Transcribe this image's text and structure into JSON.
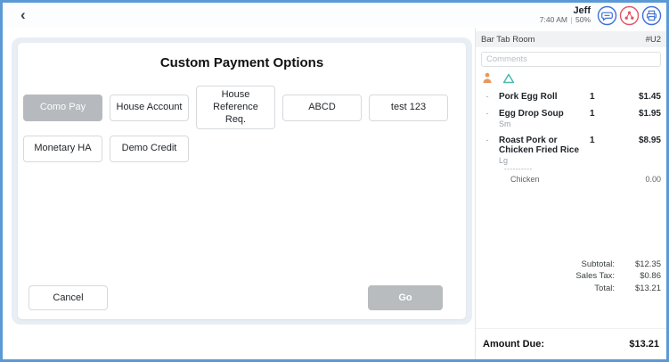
{
  "topbar": {
    "back_glyph": "‹",
    "user_name": "Jeff",
    "time": "7:40 AM",
    "battery": "50%"
  },
  "payment_modal": {
    "title": "Custom Payment Options",
    "options": [
      {
        "label": "Como Pay",
        "selected": true
      },
      {
        "label": "House Account",
        "selected": false
      },
      {
        "label": "House Reference Req.",
        "selected": false
      },
      {
        "label": "ABCD",
        "selected": false
      },
      {
        "label": "test 123",
        "selected": false
      },
      {
        "label": "Monetary HA",
        "selected": false
      },
      {
        "label": "Demo Credit",
        "selected": false
      }
    ],
    "cancel_label": "Cancel",
    "go_label": "Go"
  },
  "order_panel": {
    "room_name": "Bar Tab Room",
    "ticket_id": "#U2",
    "comments_placeholder": "Comments",
    "seat_icons": [
      "person-icon",
      "tent-icon"
    ],
    "items": [
      {
        "name": "Pork Egg Roll",
        "size": "",
        "qty": "1",
        "price": "$1.45",
        "modifiers": []
      },
      {
        "name": "Egg Drop Soup",
        "size": "Sm",
        "qty": "1",
        "price": "$1.95",
        "modifiers": []
      },
      {
        "name": "Roast Pork or Chicken Fried Rice",
        "size": "Lg",
        "qty": "1",
        "price": "$8.95",
        "modifier_separator": "----------",
        "modifiers": [
          {
            "name": "Chicken",
            "price": "0.00"
          }
        ]
      }
    ],
    "totals": [
      {
        "label": "Subtotal:",
        "value": "$12.35"
      },
      {
        "label": "Sales Tax:",
        "value": "$0.86"
      },
      {
        "label": "Total:",
        "value": "$13.21"
      }
    ],
    "amount_due_label": "Amount Due:",
    "amount_due_value": "$13.21"
  },
  "colors": {
    "frame_blue": "#5b99d5",
    "icon_blue": "#3d6fd6",
    "icon_red": "#e25663",
    "person_orange": "#e8985c",
    "tent_teal": "#4cb8ae",
    "selected_gray": "#b6b9bd"
  }
}
